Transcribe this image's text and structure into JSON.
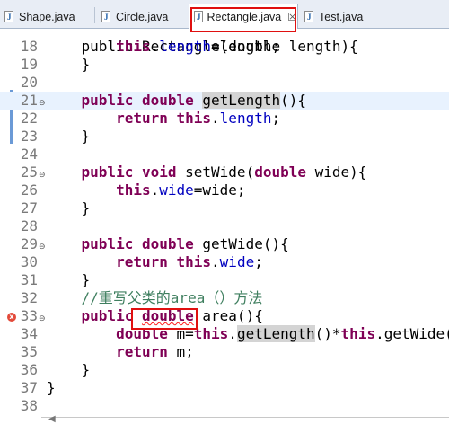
{
  "tabs": [
    {
      "label": "Shape.java",
      "icon": "java-file-icon"
    },
    {
      "label": "Circle.java",
      "icon": "java-file-icon"
    },
    {
      "label": "Rectangle.java",
      "icon": "java-file-icon",
      "active": true,
      "close": "☒"
    },
    {
      "label": "Test.java",
      "icon": "java-file-icon"
    }
  ],
  "lines": [
    {
      "n": "18",
      "tokens": [
        [
          "",
          "        "
        ],
        [
          "kw",
          "this"
        ],
        [
          "",
          "."
        ],
        [
          "fld",
          "length"
        ],
        [
          "",
          "=length;"
        ]
      ]
    },
    {
      "n": "19",
      "tokens": [
        [
          "",
          "    }"
        ]
      ]
    },
    {
      "n": "20",
      "tokens": [
        [
          "",
          ""
        ]
      ]
    },
    {
      "n": "21",
      "fold": true,
      "current": true,
      "tokens": [
        [
          "",
          "    "
        ],
        [
          "kw",
          "public"
        ],
        [
          "",
          " "
        ],
        [
          "kw",
          "double"
        ],
        [
          "",
          " "
        ],
        [
          "occ",
          "getLength"
        ],
        [
          "",
          "(){"
        ]
      ]
    },
    {
      "n": "22",
      "tokens": [
        [
          "",
          "        "
        ],
        [
          "kw",
          "return"
        ],
        [
          "",
          " "
        ],
        [
          "kw",
          "this"
        ],
        [
          "",
          "."
        ],
        [
          "fld",
          "length"
        ],
        [
          "",
          ";"
        ]
      ]
    },
    {
      "n": "23",
      "tokens": [
        [
          "",
          "    }"
        ]
      ]
    },
    {
      "n": "24",
      "tokens": [
        [
          "",
          ""
        ]
      ]
    },
    {
      "n": "25",
      "fold": true,
      "tokens": [
        [
          "",
          "    "
        ],
        [
          "kw",
          "public"
        ],
        [
          "",
          " "
        ],
        [
          "kw",
          "void"
        ],
        [
          "",
          " setWide("
        ],
        [
          "kw",
          "double"
        ],
        [
          "",
          " wide){"
        ]
      ]
    },
    {
      "n": "26",
      "tokens": [
        [
          "",
          "        "
        ],
        [
          "kw",
          "this"
        ],
        [
          "",
          "."
        ],
        [
          "fld",
          "wide"
        ],
        [
          "",
          "=wide;"
        ]
      ]
    },
    {
      "n": "27",
      "tokens": [
        [
          "",
          "    }"
        ]
      ]
    },
    {
      "n": "28",
      "tokens": [
        [
          "",
          ""
        ]
      ]
    },
    {
      "n": "29",
      "fold": true,
      "tokens": [
        [
          "",
          "    "
        ],
        [
          "kw",
          "public"
        ],
        [
          "",
          " "
        ],
        [
          "kw",
          "double"
        ],
        [
          "",
          " getWide(){"
        ]
      ]
    },
    {
      "n": "30",
      "tokens": [
        [
          "",
          "        "
        ],
        [
          "kw",
          "return"
        ],
        [
          "",
          " "
        ],
        [
          "kw",
          "this"
        ],
        [
          "",
          "."
        ],
        [
          "fld",
          "wide"
        ],
        [
          "",
          ";"
        ]
      ]
    },
    {
      "n": "31",
      "tokens": [
        [
          "",
          "    }"
        ]
      ]
    },
    {
      "n": "32",
      "tokens": [
        [
          "",
          "    "
        ],
        [
          "cm",
          "//重写父类的area（）方法"
        ]
      ]
    },
    {
      "n": "33",
      "fold": true,
      "error": true,
      "tokens": [
        [
          "",
          "    "
        ],
        [
          "kw",
          "public"
        ],
        [
          "",
          " "
        ],
        [
          "kwerr",
          "double"
        ],
        [
          "",
          " area(){"
        ]
      ]
    },
    {
      "n": "34",
      "tokens": [
        [
          "",
          "        "
        ],
        [
          "kw",
          "double"
        ],
        [
          "",
          " m="
        ],
        [
          "kw",
          "this"
        ],
        [
          "",
          "."
        ],
        [
          "occ",
          "getLength"
        ],
        [
          "",
          "()*"
        ],
        [
          "kw",
          "this"
        ],
        [
          "",
          ".getWide();"
        ]
      ]
    },
    {
      "n": "35",
      "tokens": [
        [
          "",
          "        "
        ],
        [
          "kw",
          "return"
        ],
        [
          "",
          " m;"
        ]
      ]
    },
    {
      "n": "36",
      "tokens": [
        [
          "",
          "    }"
        ]
      ]
    },
    {
      "n": "37",
      "tokens": [
        [
          "",
          "}"
        ]
      ]
    },
    {
      "n": "38",
      "tokens": [
        [
          "",
          ""
        ]
      ]
    }
  ],
  "partial_top_line": "    public Rectangle(double length){",
  "colors": {
    "keyword": "#7f0055",
    "field": "#0000c0",
    "comment": "#3f7f5f",
    "annotation_box": "#e01010"
  }
}
